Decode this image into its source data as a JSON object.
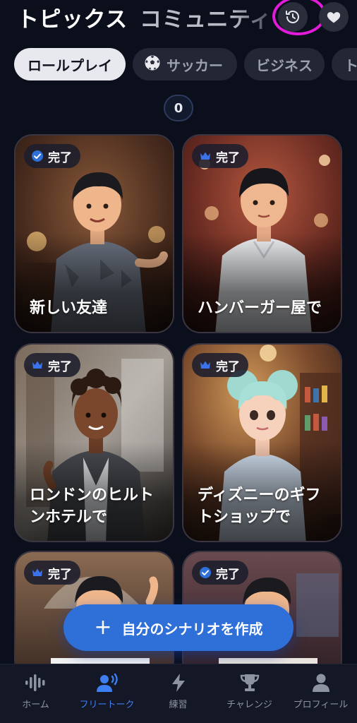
{
  "header": {
    "title": "トピックス",
    "subtitle": "コミュニティ",
    "history_icon": "history-icon",
    "heart_icon": "heart-icon"
  },
  "filters": [
    {
      "label": "ロールプレイ",
      "active": true
    },
    {
      "label": "サッカー",
      "icon": "soccer-ball-icon",
      "active": false
    },
    {
      "label": "ビジネス",
      "active": false
    },
    {
      "label": "ト",
      "active": false
    }
  ],
  "counter": "0",
  "cards": [
    {
      "badge": "完了",
      "badge_icon": "check-circle-icon",
      "title": "新しい友達"
    },
    {
      "badge": "完了",
      "badge_icon": "crown-icon",
      "title": "ハンバーガー屋で"
    },
    {
      "badge": "完了",
      "badge_icon": "crown-icon",
      "title": "ロンドンのヒルトンホテルで"
    },
    {
      "badge": "完了",
      "badge_icon": "crown-icon",
      "title": "ディズニーのギフトショップで"
    },
    {
      "badge": "完了",
      "badge_icon": "crown-icon",
      "title": ""
    },
    {
      "badge": "完了",
      "badge_icon": "check-circle-icon",
      "title": ""
    }
  ],
  "create_button": {
    "label": "自分のシナリオを作成"
  },
  "bottom_nav": [
    {
      "label": "ホーム",
      "icon": "waveform-icon",
      "active": false
    },
    {
      "label": "フリートーク",
      "icon": "speaking-person-icon",
      "active": true
    },
    {
      "label": "練習",
      "icon": "lightning-icon",
      "active": false
    },
    {
      "label": "チャレンジ",
      "icon": "trophy-icon",
      "active": false
    },
    {
      "label": "プロフィール",
      "icon": "person-icon",
      "active": false
    }
  ],
  "colors": {
    "background": "#0b0f1c",
    "accent": "#2f6fd8",
    "nav_active": "#3d7ef0",
    "annotation": "#e21bd8"
  }
}
